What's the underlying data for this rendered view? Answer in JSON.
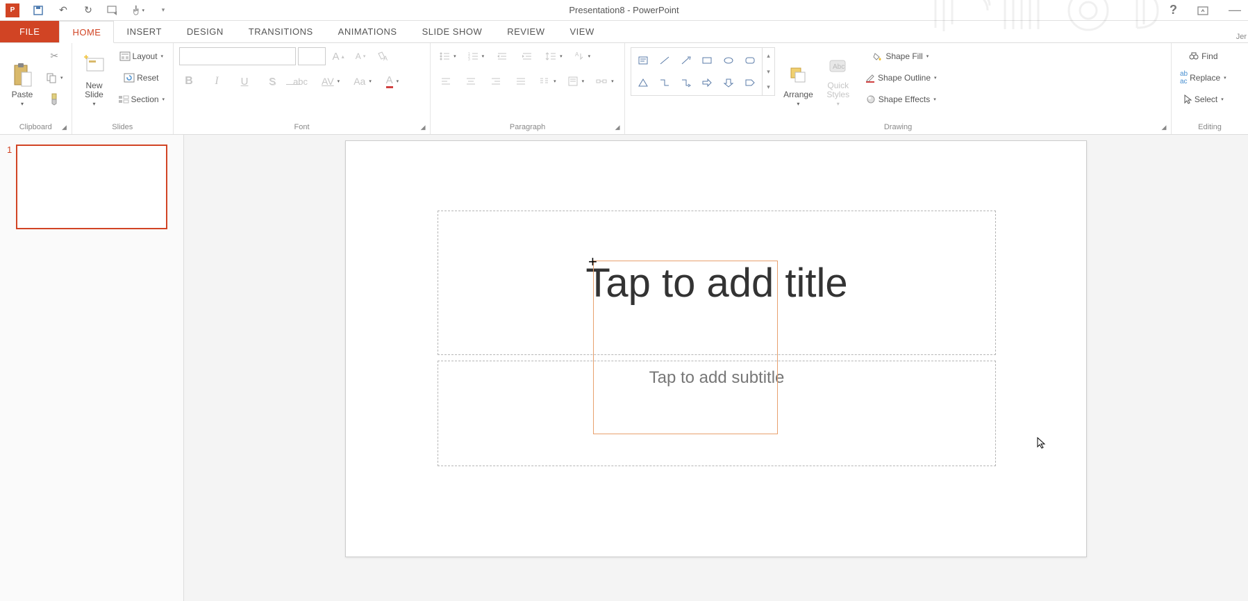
{
  "title": "Presentation8 - PowerPoint",
  "user": "Jer",
  "tabs": {
    "file": "FILE",
    "home": "HOME",
    "insert": "INSERT",
    "design": "DESIGN",
    "transitions": "TRANSITIONS",
    "animations": "ANIMATIONS",
    "slideshow": "SLIDE SHOW",
    "review": "REVIEW",
    "view": "VIEW"
  },
  "ribbon": {
    "clipboard": {
      "label": "Clipboard",
      "paste": "Paste"
    },
    "slides": {
      "label": "Slides",
      "newslide": "New\nSlide",
      "layout": "Layout",
      "reset": "Reset",
      "section": "Section"
    },
    "font": {
      "label": "Font"
    },
    "paragraph": {
      "label": "Paragraph"
    },
    "drawing": {
      "label": "Drawing",
      "arrange": "Arrange",
      "quickstyles": "Quick\nStyles",
      "shapefill": "Shape Fill",
      "shapeoutline": "Shape Outline",
      "shapeeffects": "Shape Effects"
    },
    "editing": {
      "label": "Editing",
      "find": "Find",
      "replace": "Replace",
      "select": "Select"
    }
  },
  "slide": {
    "number": "1",
    "title_placeholder": "Tap to add title",
    "subtitle_placeholder": "Tap to add subtitle"
  }
}
